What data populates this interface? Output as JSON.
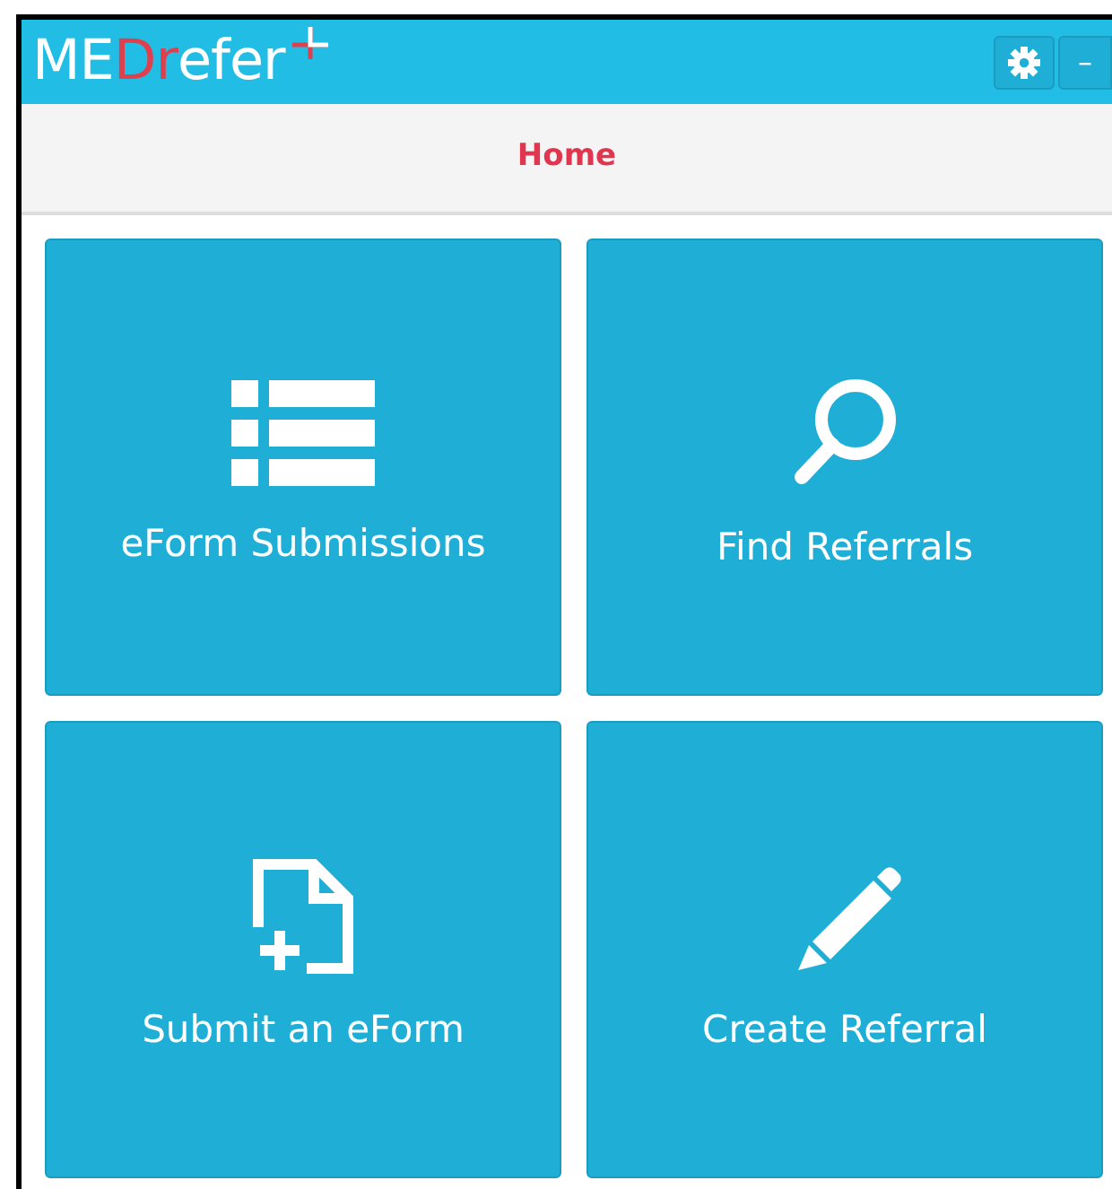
{
  "header": {
    "logo": [
      {
        "text": "ME",
        "accent": false
      },
      {
        "text": "Dr",
        "accent": true
      },
      {
        "text": "efer",
        "accent": false
      }
    ],
    "buttons": [
      {
        "kind": "gear"
      },
      {
        "kind": "text",
        "label": "–"
      }
    ]
  },
  "nav": {
    "title": "Home"
  },
  "tiles": [
    {
      "label": "eForm Submissions"
    },
    {
      "label": "Find Referrals"
    },
    {
      "label": "Submit an eForm"
    },
    {
      "label": "Create Referral"
    }
  ]
}
